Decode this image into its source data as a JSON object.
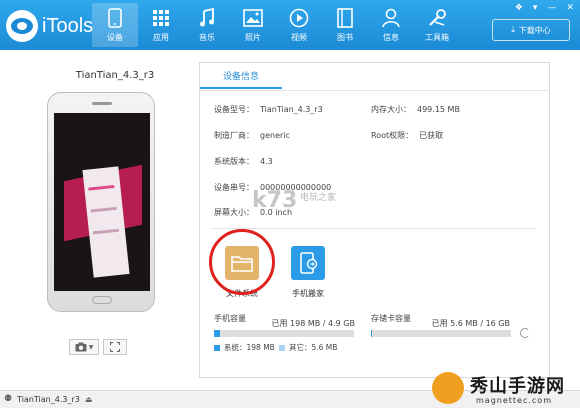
{
  "app": {
    "title": "iTools"
  },
  "nav": [
    {
      "label": "设备",
      "icon": "device-icon",
      "active": true
    },
    {
      "label": "应用",
      "icon": "apps-icon"
    },
    {
      "label": "音乐",
      "icon": "music-icon"
    },
    {
      "label": "照片",
      "icon": "photo-icon"
    },
    {
      "label": "视频",
      "icon": "video-icon"
    },
    {
      "label": "图书",
      "icon": "book-icon"
    },
    {
      "label": "信息",
      "icon": "contact-icon"
    },
    {
      "label": "工具箱",
      "icon": "toolbox-icon"
    }
  ],
  "download_center": {
    "label": "下载中心",
    "icon": "download-icon"
  },
  "device": {
    "name": "TianTian_4.3_r3"
  },
  "tab": {
    "label": "设备信息"
  },
  "info": {
    "model_label": "设备型号：",
    "model_value": "TianTian_4.3_r3",
    "memory_label": "内存大小：",
    "memory_value": "499.15 MB",
    "maker_label": "制造厂商：",
    "maker_value": "generic",
    "root_label": "Root权限：",
    "root_value": "已获取",
    "version_label": "系统版本：",
    "version_value": "4.3",
    "serial_label": "设备串号：",
    "serial_value": "00000000000000",
    "size_label": "屏幕大小：",
    "size_value": "0.0 inch"
  },
  "tools": [
    {
      "label": "文件系统",
      "icon": "folder-icon",
      "color": "#e3b46a"
    },
    {
      "label": "手机搬家",
      "icon": "phone-transfer-icon",
      "color": "#2b9be5"
    }
  ],
  "storage": {
    "phone": {
      "title": "手机容量",
      "used_text": "已用 198 MB / 4.9 GB",
      "fraction": 0.04
    },
    "sd": {
      "title": "存储卡容量",
      "used_text": "已用 5.6 MB / 16 GB",
      "fraction": 0.0004
    },
    "legend": [
      {
        "label": "系统：198 MB",
        "color": "#2b9be5"
      },
      {
        "label": "其它：5.6 MB",
        "color": "#a9d4f2"
      }
    ]
  },
  "statusbar": {
    "device": "TianTian_4.3_r3"
  },
  "watermark": {
    "k73": "k73",
    "k73_sub": "电玩之家",
    "brand": "秀山手游网",
    "brand_sub": "magnettec.com"
  }
}
